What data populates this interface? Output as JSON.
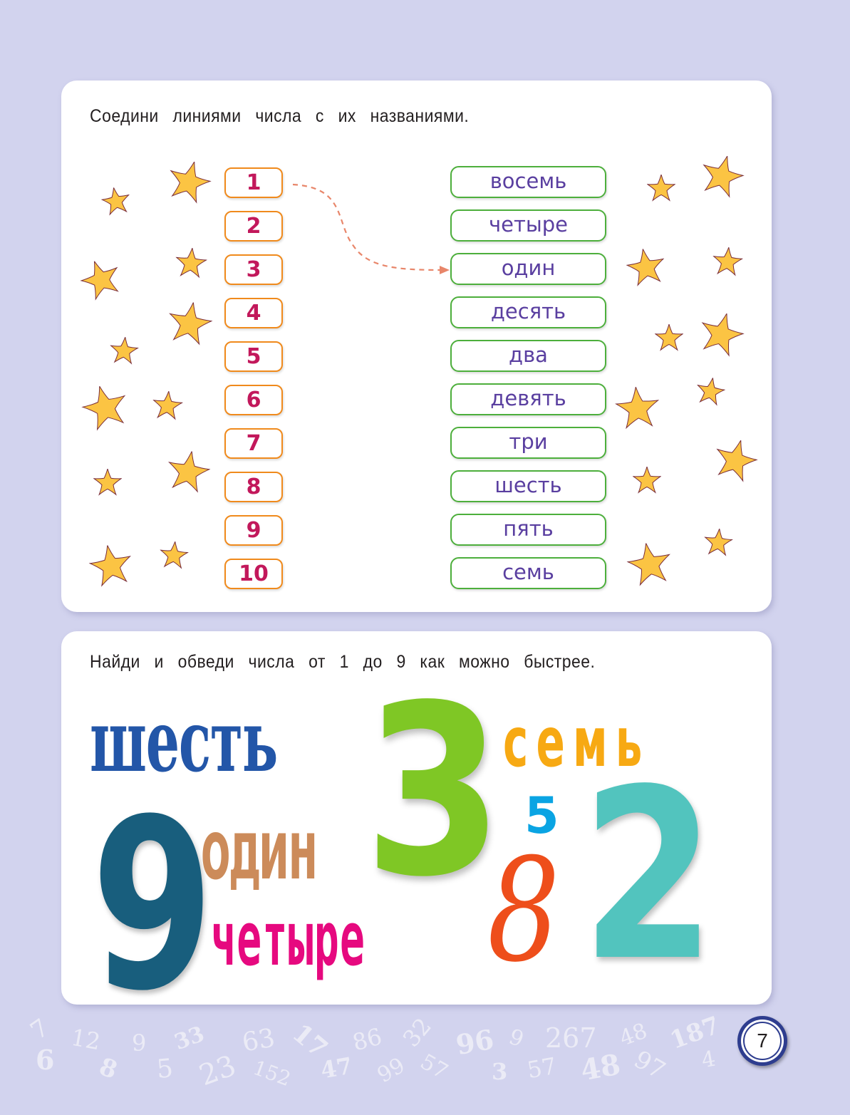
{
  "exercise1": {
    "instruction": "Соедини линиями числа с их названиями.",
    "numbers": [
      "1",
      "2",
      "3",
      "4",
      "5",
      "6",
      "7",
      "8",
      "9",
      "10"
    ],
    "words": [
      "восемь",
      "четыре",
      "один",
      "десять",
      "два",
      "девять",
      "три",
      "шесть",
      "пять",
      "семь"
    ],
    "example_connection": {
      "from": "1",
      "to": "один"
    },
    "colors": {
      "number_border": "#F08A1C",
      "number_text": "#C2185B",
      "word_border": "#4DAF3C",
      "word_text": "#5A3FA0",
      "star_fill": "#FBC443",
      "arrow": "#E8866A"
    }
  },
  "exercise2": {
    "instruction": "Найди и обведи числа от 1 до 9 как можно быстрее.",
    "items": {
      "shest": "шесть",
      "three": "3",
      "sem": "семь",
      "five": "5",
      "nine": "9",
      "odin": "один",
      "chetyre": "четыре",
      "eight": "8",
      "two": "2"
    }
  },
  "background_numbers": [
    "7",
    "6",
    "12",
    "8",
    "9",
    "5",
    "33",
    "23",
    "63",
    "152",
    "17",
    "47",
    "86",
    "99",
    "32",
    "57",
    "96",
    "3",
    "9",
    "267",
    "57",
    "48",
    "48",
    "97",
    "187",
    "4"
  ],
  "page_number": "7"
}
